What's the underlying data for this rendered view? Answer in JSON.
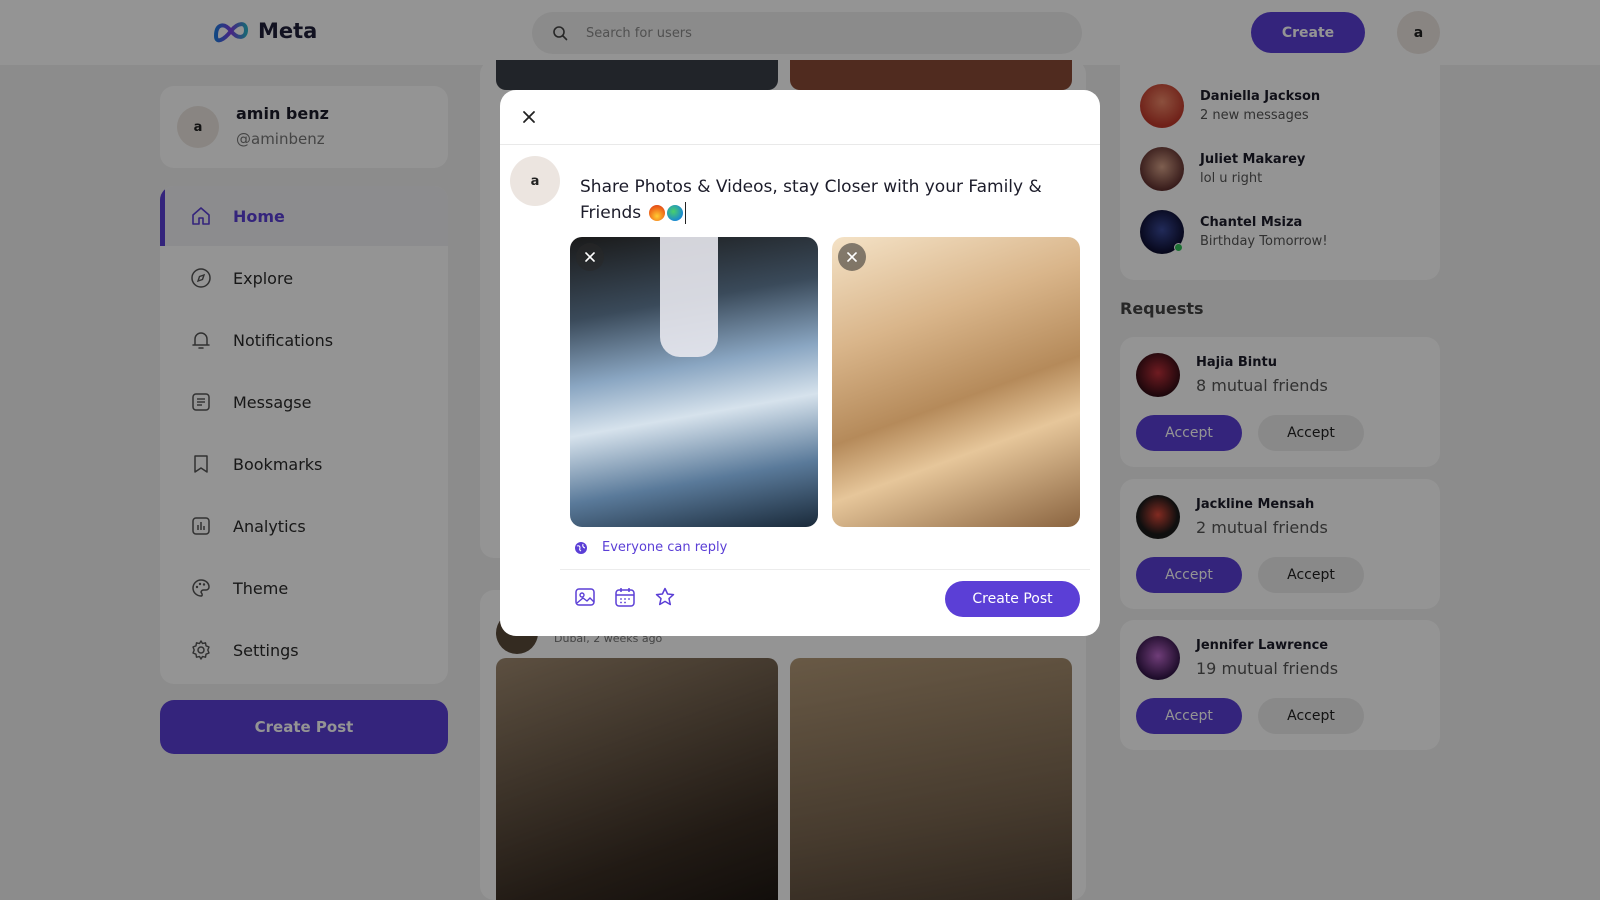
{
  "brand": {
    "name": "Meta"
  },
  "search": {
    "placeholder": "Search for users"
  },
  "header": {
    "create_label": "Create",
    "avatar_letter": "a"
  },
  "profile": {
    "avatar_letter": "a",
    "name": "amin benz",
    "handle": "@aminbenz"
  },
  "nav": {
    "items": [
      {
        "label": "Home",
        "icon": "home-icon",
        "active": true
      },
      {
        "label": "Explore",
        "icon": "compass-icon"
      },
      {
        "label": "Notifications",
        "icon": "bell-icon"
      },
      {
        "label": "Messagse",
        "icon": "message-icon"
      },
      {
        "label": "Bookmarks",
        "icon": "bookmark-icon"
      },
      {
        "label": "Analytics",
        "icon": "analytics-icon"
      },
      {
        "label": "Theme",
        "icon": "palette-icon"
      },
      {
        "label": "Settings",
        "icon": "gear-icon"
      }
    ],
    "create_post_label": "Create Post"
  },
  "feed": {
    "post_location": "Dubai, 2 weeks ago"
  },
  "messages": [
    {
      "name": "Daniella Jackson",
      "preview": "2 new messages"
    },
    {
      "name": "Juliet Makarey",
      "preview": "lol u right"
    },
    {
      "name": "Chantel Msiza",
      "preview": "Birthday Tomorrow!",
      "online": true
    }
  ],
  "requests": {
    "title": "Requests",
    "items": [
      {
        "name": "Hajia Bintu",
        "mutual": "8 mutual friends",
        "accept_label": "Accept",
        "second_label": "Accept"
      },
      {
        "name": "Jackline Mensah",
        "mutual": "2 mutual friends",
        "accept_label": "Accept",
        "second_label": "Accept"
      },
      {
        "name": "Jennifer Lawrence",
        "mutual": "19 mutual friends",
        "accept_label": "Accept",
        "second_label": "Accept"
      }
    ]
  },
  "modal": {
    "avatar_letter": "a",
    "text": "Share Photos & Videos, stay Closer with your Family & Friends",
    "reply_setting": "Everyone can reply",
    "submit_label": "Create Post",
    "tools": [
      "image-icon",
      "calendar-icon",
      "star-icon"
    ]
  },
  "colors": {
    "accent": "#5b3fd6",
    "background": "#f2f2f2",
    "online": "#32c35b"
  }
}
